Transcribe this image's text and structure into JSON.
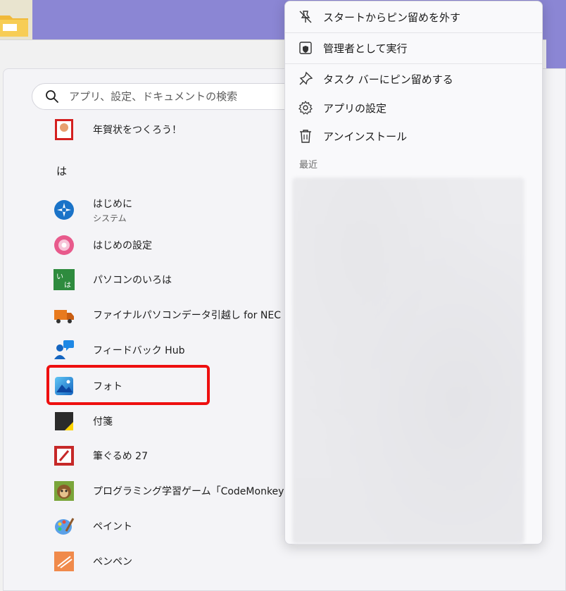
{
  "search": {
    "placeholder": "アプリ、設定、ドキュメントの検索"
  },
  "apps": {
    "partial_top": {
      "name": "年賀状をつくろう！",
      "icon": "nengajo-icon"
    },
    "section_letter": "は",
    "items": [
      {
        "name": "はじめに",
        "sub": "システム",
        "icon": "get-started-icon"
      },
      {
        "name": "はじめの設定",
        "icon": "setup-flower-icon"
      },
      {
        "name": "パソコンのいろは",
        "icon": "iroha-icon"
      },
      {
        "name": "ファイナルパソコンデータ引越し for NEC",
        "icon": "moving-truck-icon"
      },
      {
        "name": "フィードバック Hub",
        "icon": "feedback-hub-icon"
      },
      {
        "name": "フォト",
        "icon": "photos-icon"
      },
      {
        "name": "付箋",
        "icon": "sticky-notes-icon"
      },
      {
        "name": "筆ぐるめ 27",
        "icon": "fudegurume-icon"
      },
      {
        "name": "プログラミング学習ゲーム「CodeMonkey（コー",
        "icon": "codemonkey-icon"
      },
      {
        "name": "ペイント",
        "icon": "paint-icon"
      },
      {
        "name": "ペンペン",
        "icon": "penpen-icon"
      }
    ]
  },
  "context_menu": {
    "items": [
      {
        "label": "スタートからピン留めを外す",
        "icon": "unpin-icon"
      },
      {
        "label": "管理者として実行",
        "icon": "shield-icon"
      },
      {
        "label": "タスク バーにピン留めする",
        "icon": "pin-icon"
      },
      {
        "label": "アプリの設定",
        "icon": "gear-icon"
      },
      {
        "label": "アンインストール",
        "icon": "trash-icon"
      }
    ],
    "recent_label": "最近"
  },
  "colors": {
    "highlight": "#ee0f0f",
    "desktop": "#8b86d4",
    "menu_bg": "#f9f9fb"
  }
}
